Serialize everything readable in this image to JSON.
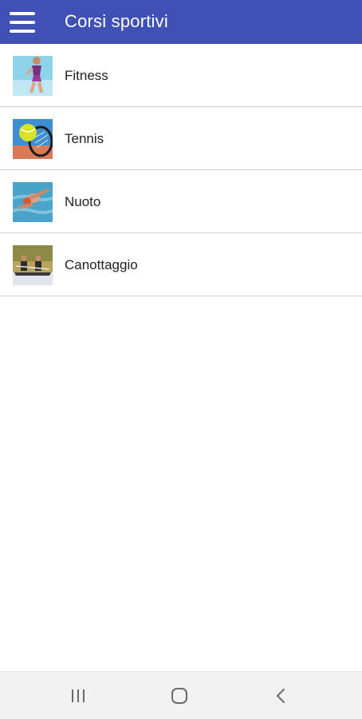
{
  "app_bar": {
    "title": "Corsi sportivi",
    "color": "#3f51b5",
    "menu_icon": "hamburger-menu-icon"
  },
  "courses": [
    {
      "label": "Fitness",
      "thumbnail": "fitness-photo"
    },
    {
      "label": "Tennis",
      "thumbnail": "tennis-photo"
    },
    {
      "label": "Nuoto",
      "thumbnail": "swimming-photo"
    },
    {
      "label": "Canottaggio",
      "thumbnail": "rowing-photo"
    }
  ],
  "nav_bar": {
    "recents_icon": "recents-icon",
    "home_icon": "home-icon",
    "back_icon": "back-icon"
  }
}
